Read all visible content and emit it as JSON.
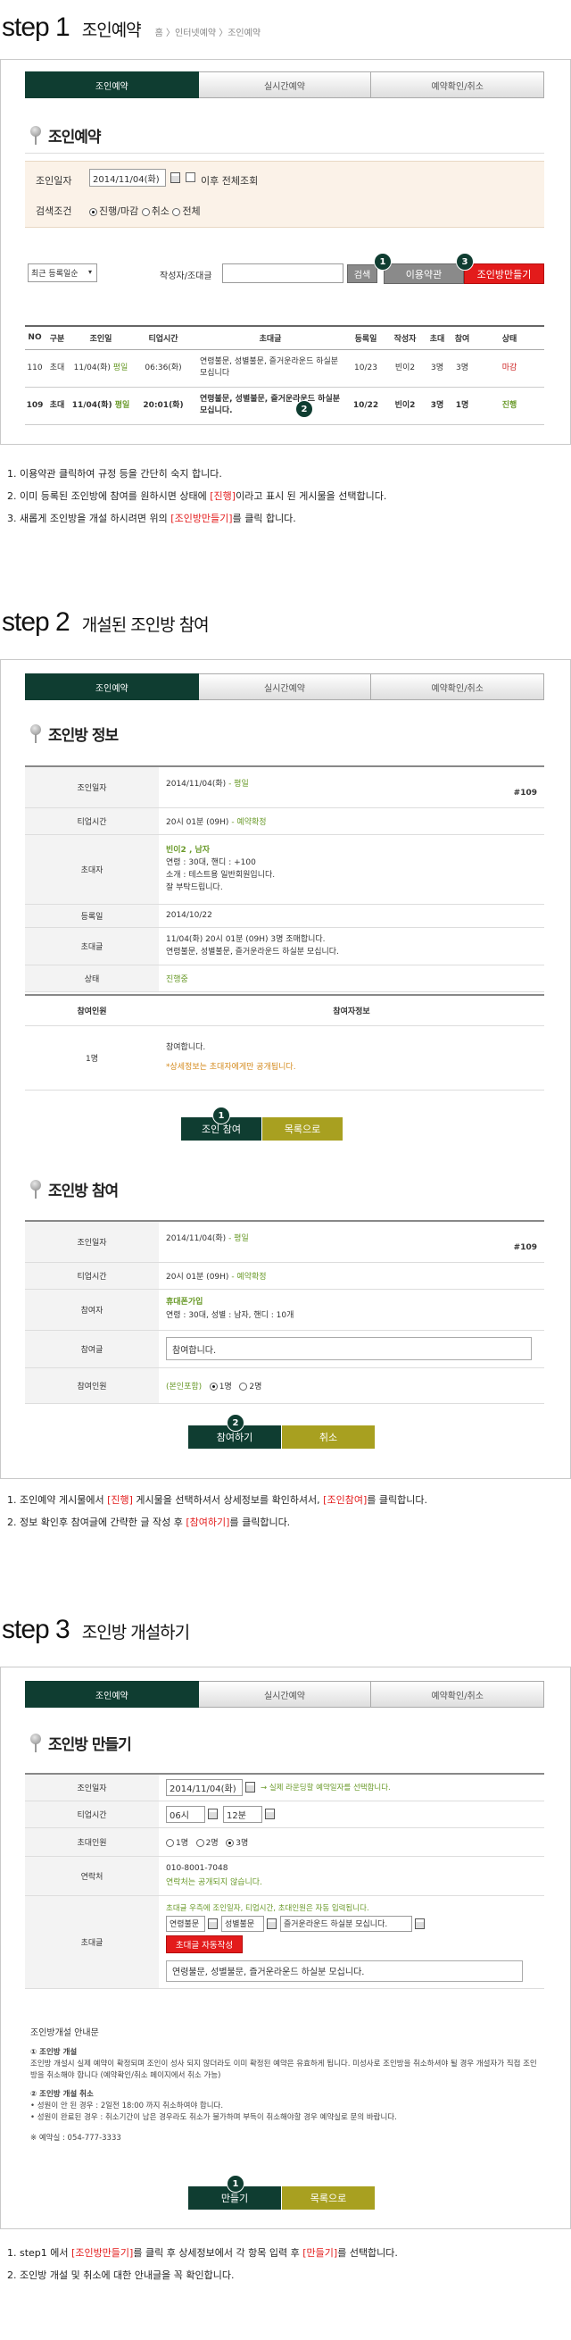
{
  "s1": {
    "step": "step 1",
    "title": "조인예약",
    "crumb": "홈 〉인터넷예약 〉조인예약",
    "tabs": [
      "조인예약",
      "실시간예약",
      "예약확인/취소"
    ],
    "section": "조인예약",
    "date_label": "조인일자",
    "date_value": "2014/11/04(화)",
    "after_label": "이후 전체조회",
    "cond_label": "검색조건",
    "cond_opts": [
      "진행/마감",
      "취소",
      "전체"
    ],
    "sort_value": "최근 등록일순",
    "author_label": "작성자/조대글",
    "search_btn": "검색",
    "terms_btn": "이용약관",
    "make_btn": "조인방만들기",
    "headers": [
      "NO",
      "구분",
      "조인일",
      "티업시간",
      "초대글",
      "등록일",
      "작성자",
      "초대",
      "참여",
      "상태"
    ],
    "rows": [
      {
        "no": "110",
        "type": "초대",
        "date": "11/04(화)",
        "day": "평일",
        "time": "06:36(화)",
        "text": "연령불문, 성별불문, 즐거운라운드 하실분 모십니다",
        "reg": "10/23",
        "author": "빈이2",
        "inv": "3명",
        "join": "3명",
        "status": "마감"
      },
      {
        "no": "109",
        "type": "초대",
        "date": "11/04(화)",
        "day": "평일",
        "time": "20:01(화)",
        "text": "연령불문, 성별불문, 즐거운라운드 하실분 모십니다.",
        "reg": "10/22",
        "author": "빈이2",
        "inv": "3명",
        "join": "1명",
        "status": "진행"
      }
    ],
    "badges": [
      "1",
      "2",
      "3"
    ],
    "notes": {
      "n1": "1. 이용약관 클릭하여 규정 등을 간단히 숙지 합니다.",
      "n2a": "2. 이미 등록된 조인방에 참여를 원하시면 상태에",
      "n2b": "[진행]",
      "n2c": "이라고 표시 된 게시물을 선택합니다.",
      "n3a": "3. 새롭게 조인방을 개설 하시려면 위의",
      "n3b": "[조인방만들기]",
      "n3c": "를 클릭 합니다."
    }
  },
  "s2": {
    "step": "step 2",
    "title": "개설된 조인방 참여",
    "info_title": "조인방 정보",
    "rows": {
      "date_l": "조인일자",
      "date_v": "2014/11/04(화)",
      "date_day": "- 평일",
      "no": "#109",
      "time_l": "티업시간",
      "time_v": "20시 01분 (09H)",
      "time_s": "- 예약확정",
      "inv_l": "초대자",
      "inv_name": "빈이2 , 남자",
      "inv_1": "연령 : 30대, 핸디 : +100",
      "inv_2": "소개 : 테스트용 일반회원입니다.",
      "inv_3": "잘 부탁드립니다.",
      "reg_l": "등록일",
      "reg_v": "2014/10/22",
      "msg_l": "초대글",
      "msg_1": "11/04(화) 20시 01분 (09H) 3명 조매합니다.",
      "msg_2": "연령불문, 성별불문, 즐거운라운드 하실분 모십니다.",
      "st_l": "상태",
      "st_v": "진행중"
    },
    "part_h1": "참여인원",
    "part_h2": "참여자정보",
    "part_cnt": "1명",
    "part_1": "참여합니다.",
    "part_2": "*상세정보는 초대자에게만 공개됩니다.",
    "btn_join": "조인 참여",
    "btn_list": "목록으로",
    "join_title": "조인방 참여",
    "j": {
      "date_l": "조인일자",
      "date_v": "2014/11/04(화)",
      "date_day": "- 평일",
      "no": "#109",
      "time_l": "티업시간",
      "time_v": "20시 01분 (09H)",
      "time_s": "- 예약확정",
      "p_l": "참여자",
      "p_name": "휴대폰가입",
      "p_info": "연령 : 30대, 성별 : 남자, 핸디 : 10개",
      "m_l": "참여글",
      "m_v": "참여합니다.",
      "c_l": "참여인원",
      "c_pre": "(본인포함)",
      "c_o1": "1명",
      "c_o2": "2명"
    },
    "btn_do": "참여하기",
    "btn_cancel": "취소",
    "notes": {
      "n1a": "1. 조인예약 게시물에서",
      "n1b": "[진행]",
      "n1c": "게시물을 선택하셔서 상세정보를 확인하셔서,",
      "n1d": "[조인참여]",
      "n1e": "를 클릭합니다.",
      "n2a": "2. 정보 확인후 참여글에 간략한 글 작성 후",
      "n2b": "[참여하기]",
      "n2c": "를 클릭합니다."
    }
  },
  "s3": {
    "step": "step 3",
    "title": "조인방 개설하기",
    "section": "조인방 만들기",
    "date_l": "조인일자",
    "date_v": "2014/11/04(화)",
    "date_hint": "→ 실제 라운딩할 예약일자를 선택합니다.",
    "time_l": "티업시간",
    "hour_v": "06시",
    "min_v": "12분",
    "cnt_l": "초대인원",
    "cnt_opts": [
      "1명",
      "2명",
      "3명"
    ],
    "contact_l": "연락처",
    "contact_v": "010-8001-7048",
    "contact_h": "연락처는 공개되지 않습니다.",
    "msg_l": "초대글",
    "msg_hint": "초대글 우측에 조인일자, 티업시간, 초대인원은 자동 입력됩니다.",
    "sel1": "연령불문",
    "sel2": "성별불문",
    "sel3": "즐거운라운드 하실분 모십니다.",
    "auto_btn": "초대글 자동작성",
    "msg_v": "연령불문, 성별불문, 즐거운라운드 하실분 모십니다.",
    "guide_title": "조인방개설 안내문",
    "g1_t": "① 조인방 개설",
    "g1_b": "조인방 개설시 실제 예약이 확정되며 조인이 성사 되지 않더라도 이미 확정된 예약은 유효하게 됩니다. 미성사로 조인방을 취소하셔야 될 경우 개설자가 직접 조인방을 취소해야 합니다 (예약확인/취소 페이지에서 취소 가능)",
    "g2_t": "② 조인방 개설 취소",
    "g2_b1": "• 성원이 안 된 경우 : 2일전 18:00 까지 취소하여야 합니다.",
    "g2_b2": "• 성원이 완료된 경우 : 취소기간이 남은 경우라도 취소가 불가하며 부득이 취소해야할 경우 예약실로 문의 바랍니다.",
    "g3": "※ 예약실 : 054-777-3333",
    "btn_make": "만들기",
    "btn_list": "목록으로",
    "notes": {
      "n1a": "1. step1 에서",
      "n1b": "[조인방만들기]",
      "n1c": "를 클릭 후 상세정보에서 각 항목 입력 후",
      "n1d": "[만들기]",
      "n1e": "를 선택합니다.",
      "n2": "2. 조인방 개설 및 취소에 대한 안내글을 꼭 확인합니다."
    }
  },
  "colors": {
    "brand": "#0f3d31",
    "accent_red": "#e31b1b",
    "olive": "#a8a020",
    "green": "#6a9a2a"
  }
}
